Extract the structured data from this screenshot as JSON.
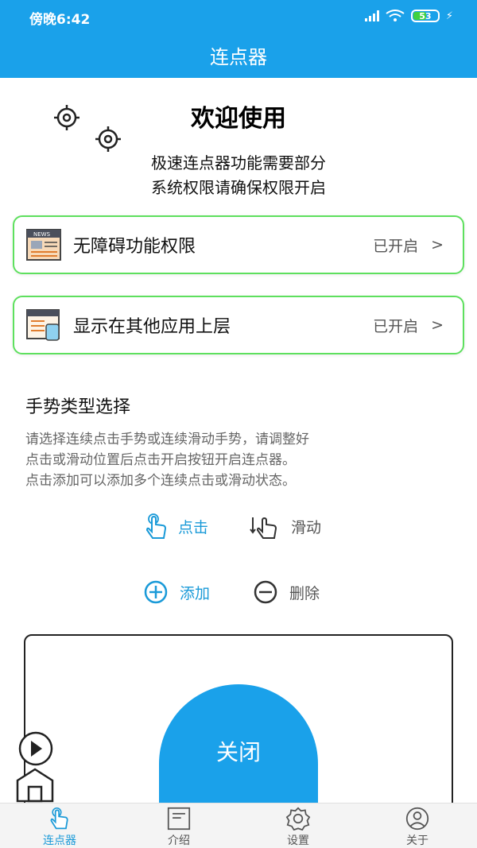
{
  "status_bar": {
    "time": "傍晚6:42",
    "battery": "53"
  },
  "app": {
    "title": "连点器"
  },
  "welcome": {
    "title": "欢迎使用",
    "desc_line1": "极速连点器功能需要部分",
    "desc_line2": "系统权限请确保权限开启"
  },
  "permissions": [
    {
      "label": "无障碍功能权限",
      "status": "已开启",
      "chevron": ">",
      "icon": "news-icon"
    },
    {
      "label": "显示在其他应用上层",
      "status": "已开启",
      "chevron": ">",
      "icon": "overlay-window-icon"
    }
  ],
  "gesture": {
    "title": "手势类型选择",
    "desc_line1": "请选择连续点击手势或连续滑动手势，请调整好",
    "desc_line2": "点击或滑动位置后点击开启按钮开启连点器。",
    "desc_line3": "点击添加可以添加多个连续点击或滑动状态。",
    "tap_label": "点击",
    "swipe_label": "滑动",
    "add_label": "添加",
    "delete_label": "删除"
  },
  "main_button": {
    "label": "关闭"
  },
  "bottom_nav": [
    {
      "label": "连点器",
      "icon": "tap-hand-icon",
      "active": true
    },
    {
      "label": "介绍",
      "icon": "document-icon",
      "active": false
    },
    {
      "label": "设置",
      "icon": "gear-icon",
      "active": false
    },
    {
      "label": "关于",
      "icon": "user-icon",
      "active": false
    }
  ],
  "colors": {
    "primary": "#1aa1ea",
    "card_border": "#5ee05e",
    "active_text": "#1a9ad8"
  }
}
